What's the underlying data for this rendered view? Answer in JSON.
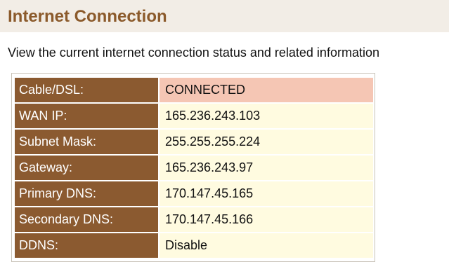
{
  "page": {
    "title": "Internet Connection",
    "description": "View the current internet connection status and related information"
  },
  "colors": {
    "title_text": "#8b5a2b",
    "header_band": "#f2ede6",
    "label_bg": "#8b5a30",
    "value_bg": "#fffbe0",
    "connected_bg": "#f5c6b4"
  },
  "status_table": {
    "rows": [
      {
        "label": "Cable/DSL:",
        "value": "CONNECTED"
      },
      {
        "label": "WAN IP:",
        "value": "165.236.243.103"
      },
      {
        "label": "Subnet Mask:",
        "value": "255.255.255.224"
      },
      {
        "label": "Gateway:",
        "value": "165.236.243.97"
      },
      {
        "label": "Primary DNS:",
        "value": "170.147.45.165"
      },
      {
        "label": "Secondary DNS:",
        "value": "170.147.45.166"
      },
      {
        "label": "DDNS:",
        "value": "Disable"
      }
    ]
  }
}
